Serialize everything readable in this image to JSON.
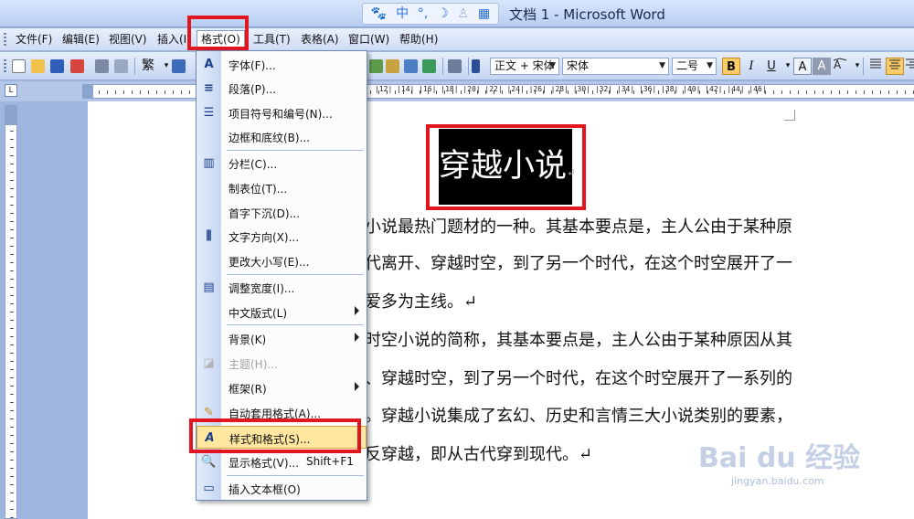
{
  "window": {
    "title": "文档 1 - Microsoft Word"
  },
  "ime": {
    "items": [
      "中",
      "°,",
      "☽",
      "♙",
      "▦"
    ]
  },
  "menubar": {
    "items": [
      "文件(F)",
      "编辑(E)",
      "视图(V)",
      "插入(I)",
      "格式(O)",
      "工具(T)",
      "表格(A)",
      "窗口(W)",
      "帮助(H)"
    ],
    "active": "格式(O)"
  },
  "toolbar": {
    "traditional_label": "繁",
    "style_value": "正文 + 宋体",
    "font_value": "宋体",
    "size_value": "二号",
    "bold": "B",
    "italic": "I",
    "underline": "U",
    "char_border": "A",
    "char_shade": "A"
  },
  "ruler": {
    "corner": "L",
    "numbers": "8 | 6 | 4 | 2 |     |2| |4| |6| |8| |10| |12| |14| |16| |18| |20| |22| |24| |26| |28| |30| |32| |34| |36| |38| |40| |42| |44| |46| |48",
    "right_numbers": "|12| |14| |16| |18| |20| |22| |24| |26| |28| |30| |32| |34| |36| |38| |40| |42| |44| |46|"
  },
  "format_menu": {
    "items": [
      {
        "label": "字体(F)...",
        "icon": "font-A-icon"
      },
      {
        "label": "段落(P)...",
        "icon": "paragraph-icon"
      },
      {
        "label": "项目符号和编号(N)...",
        "icon": "bullets-icon"
      },
      {
        "label": "边框和底纹(B)...",
        "icon": ""
      },
      {
        "label": "分栏(C)...",
        "icon": "columns-icon"
      },
      {
        "label": "制表位(T)...",
        "icon": ""
      },
      {
        "label": "首字下沉(D)...",
        "icon": ""
      },
      {
        "label": "文字方向(X)...",
        "icon": "text-direction-icon"
      },
      {
        "label": "更改大小写(E)...",
        "icon": ""
      },
      {
        "label": "调整宽度(I)...",
        "icon": "adjust-width-icon"
      },
      {
        "label": "中文版式(L)",
        "icon": ""
      },
      {
        "label": "背景(K)",
        "icon": ""
      },
      {
        "label": "主题(H)...",
        "icon": "theme-icon"
      },
      {
        "label": "框架(R)",
        "icon": ""
      },
      {
        "label": "自动套用格式(A)...",
        "icon": "autoformat-icon"
      },
      {
        "label": "样式和格式(S)...",
        "icon": "styles-icon"
      },
      {
        "label": "显示格式(V)...",
        "icon": "reveal-format-icon",
        "shortcut": "Shift+F1"
      },
      {
        "label": "插入文本框(O)",
        "icon": "textbox-icon"
      }
    ],
    "highlighted": "样式和格式(S)..."
  },
  "document": {
    "title": "穿越小说",
    "mark": "↵",
    "lines": [
      "小说最热门题材的一种。其基本要点是，主人公由于某种原",
      "代离开、穿越时空，到了另一个时代，在这个时空展开了一",
      "爱多为主线。↵",
      "时空小说的简称，其基本要点是，主人公由于某种原因从其",
      "、穿越时空，到了另一个时代，在这个时空展开了一系列的",
      "。穿越小说集成了玄幻、历史和言情三大小说类别的要素，",
      "反穿越，即从古代穿到现代。↵"
    ]
  },
  "watermark": {
    "main": "Bai du 经验",
    "sub": "jingyan.baidu.com"
  }
}
